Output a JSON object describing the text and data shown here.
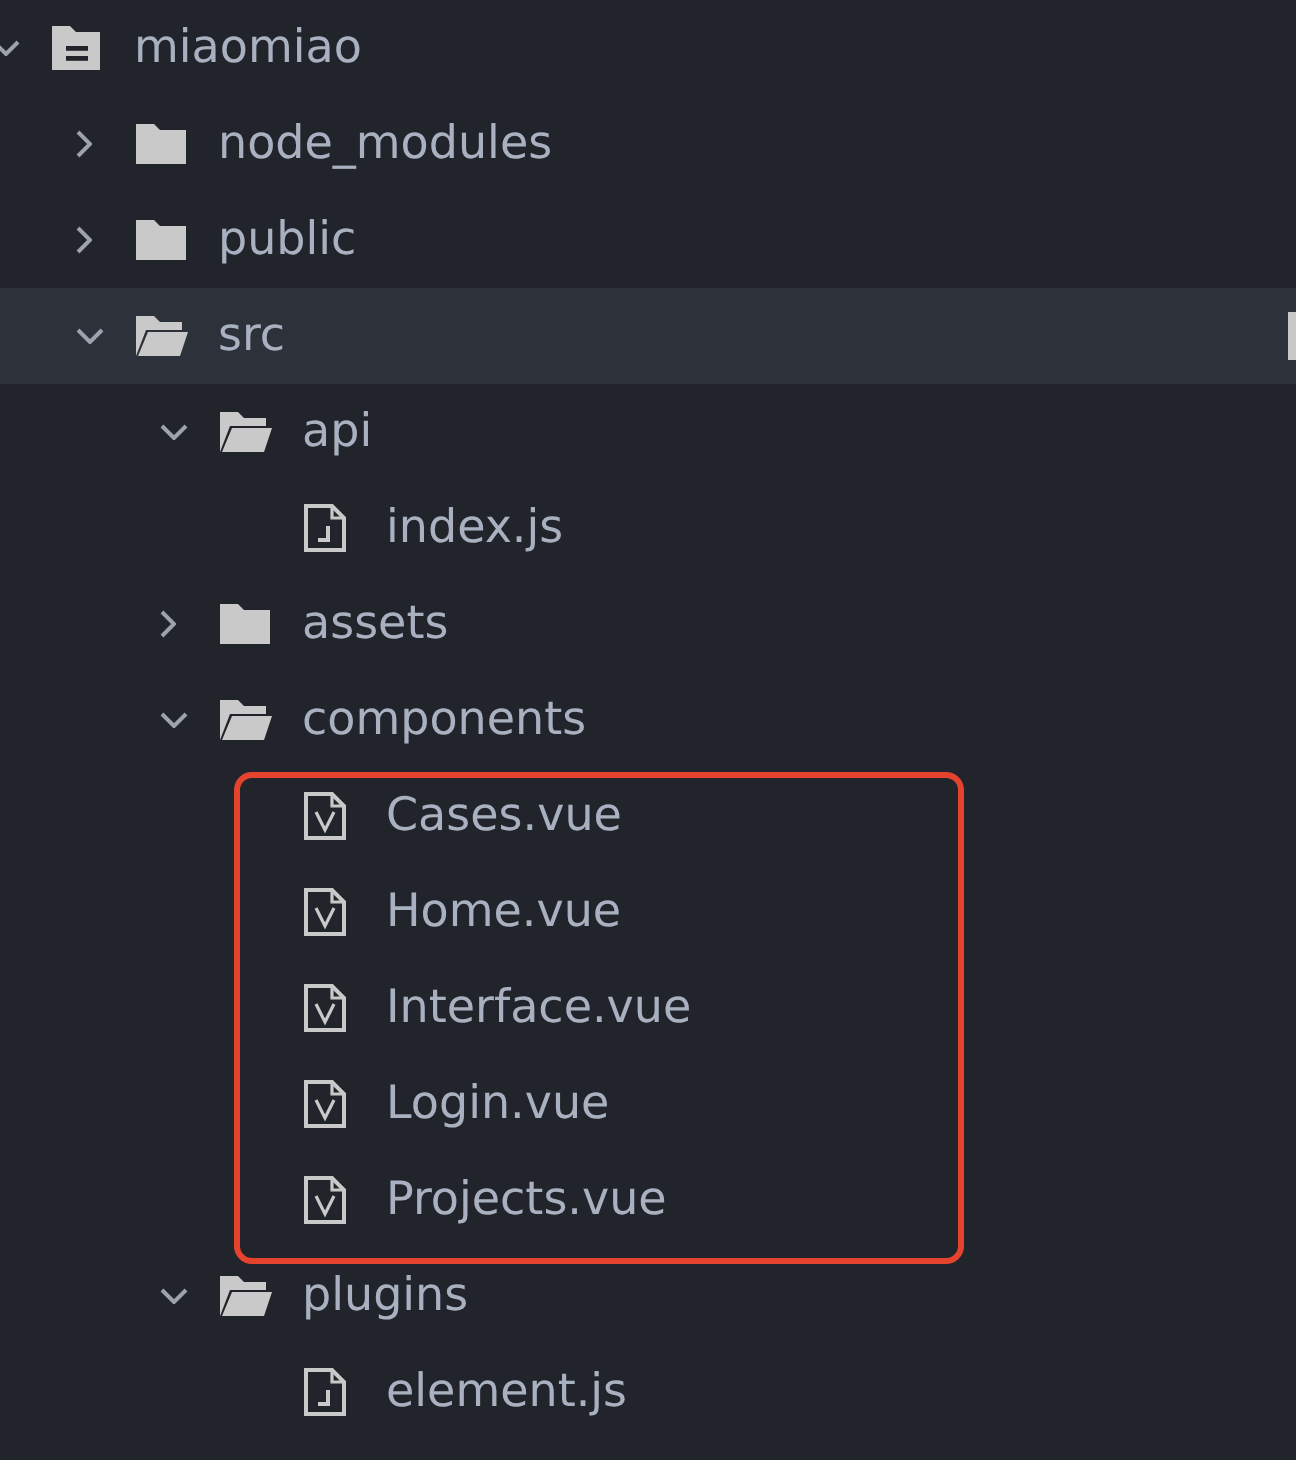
{
  "tree": [
    {
      "label": "miaomiao",
      "kind": "project",
      "expanded": true,
      "selected": false,
      "children": [
        {
          "label": "node_modules",
          "kind": "folder",
          "expanded": false,
          "selected": false
        },
        {
          "label": "public",
          "kind": "folder",
          "expanded": false,
          "selected": false
        },
        {
          "label": "src",
          "kind": "folder",
          "expanded": true,
          "selected": true,
          "children": [
            {
              "label": "api",
              "kind": "folder",
              "expanded": true,
              "selected": false,
              "children": [
                {
                  "label": "index.js",
                  "kind": "file-js",
                  "selected": false
                }
              ]
            },
            {
              "label": "assets",
              "kind": "folder",
              "expanded": false,
              "selected": false
            },
            {
              "label": "components",
              "kind": "folder",
              "expanded": true,
              "selected": false,
              "children_outlined": true,
              "children": [
                {
                  "label": "Cases.vue",
                  "kind": "file-vue",
                  "selected": false
                },
                {
                  "label": "Home.vue",
                  "kind": "file-vue",
                  "selected": false
                },
                {
                  "label": "Interface.vue",
                  "kind": "file-vue",
                  "selected": false
                },
                {
                  "label": "Login.vue",
                  "kind": "file-vue",
                  "selected": false
                },
                {
                  "label": "Projects.vue",
                  "kind": "file-vue",
                  "selected": false
                }
              ]
            },
            {
              "label": "plugins",
              "kind": "folder",
              "expanded": true,
              "selected": false,
              "children": [
                {
                  "label": "element.js",
                  "kind": "file-js",
                  "selected": false
                }
              ]
            }
          ]
        }
      ]
    }
  ]
}
